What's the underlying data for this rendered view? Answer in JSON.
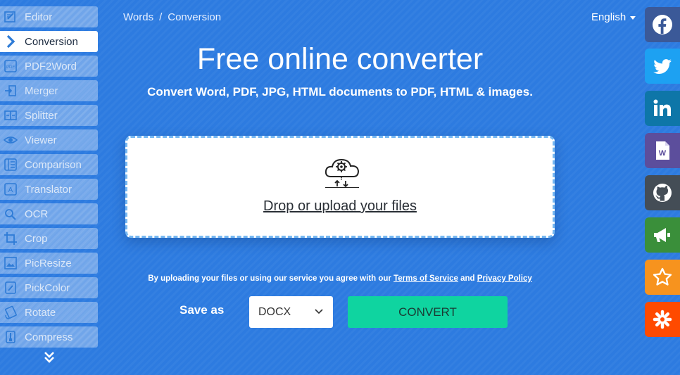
{
  "breadcrumb": {
    "root": "Words",
    "separator": "/",
    "current": "Conversion"
  },
  "language": {
    "label": "English"
  },
  "title": "Free online converter",
  "subtitle": "Convert Word, PDF, JPG, HTML documents to PDF, HTML & images.",
  "sidebar": {
    "items": [
      {
        "label": "Editor",
        "icon": "editor-icon"
      },
      {
        "label": "Conversion",
        "icon": "chevron-right-icon",
        "active": true
      },
      {
        "label": "PDF2Word",
        "icon": "pdf-icon"
      },
      {
        "label": "Merger",
        "icon": "merge-icon"
      },
      {
        "label": "Splitter",
        "icon": "split-icon"
      },
      {
        "label": "Viewer",
        "icon": "eye-icon"
      },
      {
        "label": "Comparison",
        "icon": "compare-icon"
      },
      {
        "label": "Translator",
        "icon": "translate-icon"
      },
      {
        "label": "OCR",
        "icon": "ocr-icon"
      },
      {
        "label": "Crop",
        "icon": "crop-icon"
      },
      {
        "label": "PicResize",
        "icon": "resize-icon"
      },
      {
        "label": "PickColor",
        "icon": "color-picker-icon"
      },
      {
        "label": "Rotate",
        "icon": "rotate-icon"
      },
      {
        "label": "Compress",
        "icon": "compress-icon"
      }
    ]
  },
  "dropzone": {
    "label": "Drop or upload your files"
  },
  "terms": {
    "prefix": "By uploading your files or using our service you agree with our",
    "tos": "Terms of Service",
    "and": "and",
    "privacy": "Privacy Policy"
  },
  "save_as": {
    "label": "Save as",
    "selected": "DOCX"
  },
  "convert_button": "CONVERT",
  "social": [
    {
      "name": "facebook",
      "color": "#3b5998"
    },
    {
      "name": "twitter",
      "color": "#1da1f2"
    },
    {
      "name": "linkedin",
      "color": "#0e76a8"
    },
    {
      "name": "word",
      "color": "#5c4e9c"
    },
    {
      "name": "github",
      "color": "#444d56"
    },
    {
      "name": "announcement",
      "color": "#3a8f3a"
    },
    {
      "name": "favorite",
      "color": "#f7931e"
    },
    {
      "name": "zapier",
      "color": "#ff4a00"
    }
  ]
}
